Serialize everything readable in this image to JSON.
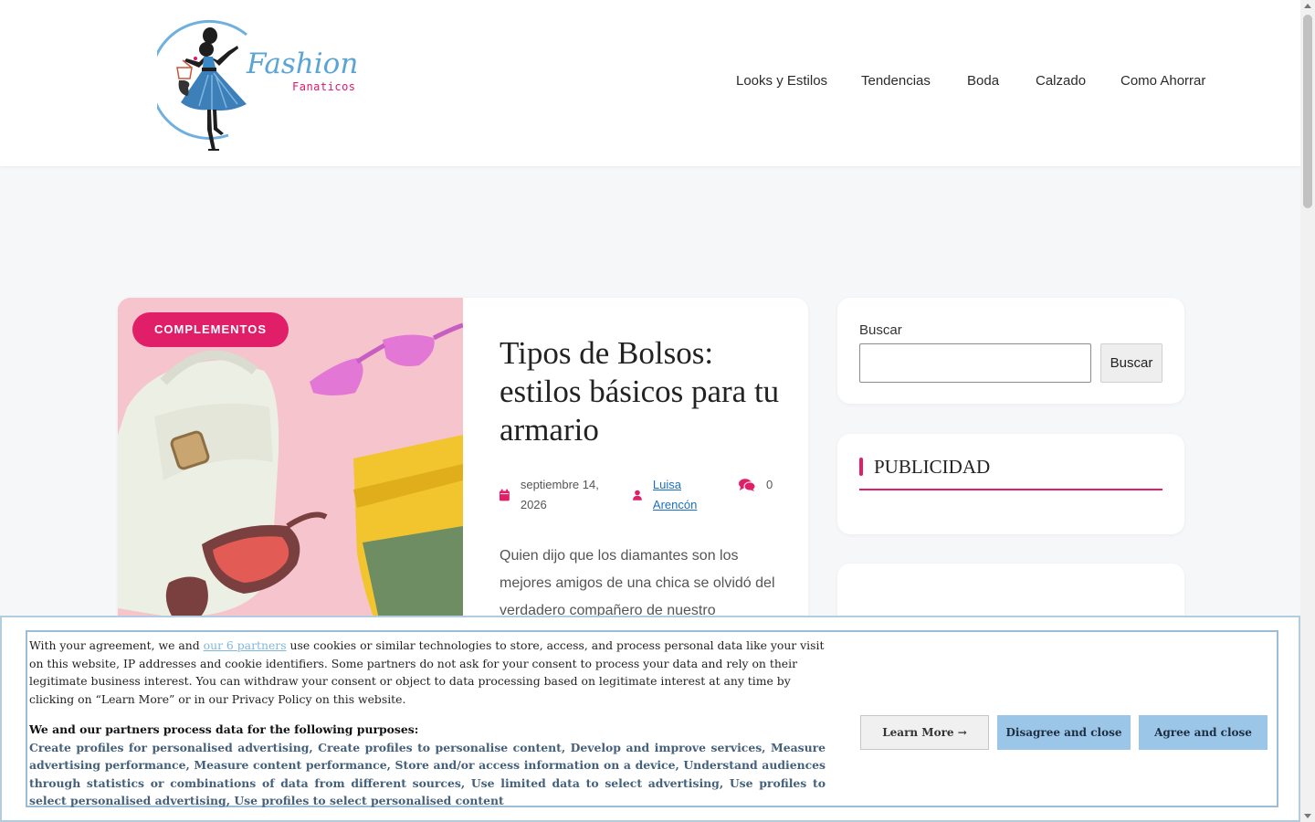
{
  "header": {
    "logo_text_main": "Fashion",
    "logo_text_sub": "Fanaticos",
    "nav": [
      "Looks y Estilos",
      "Tendencias",
      "Boda",
      "Calzado",
      "Como Ahorrar"
    ]
  },
  "article": {
    "category": "COMPLEMENTOS",
    "title": "Tipos de Bolsos: estilos básicos para tu armario",
    "date": "septiembre 14, 2026",
    "author": "Luisa Arencón",
    "comments": "0",
    "excerpt": "Quien dijo que los diamantes son los mejores amigos de una chica se olvidó del verdadero compañero de nuestro"
  },
  "sidebar": {
    "search_label": "Buscar",
    "search_value": "",
    "search_button": "Buscar",
    "ad_title": "PUBLICIDAD"
  },
  "cookie": {
    "intro_before_link": "With your agreement, we and ",
    "partners_link": "our 6 partners",
    "intro_after_link": " use cookies or similar technologies to store, access, and process personal data like your visit on this website, IP addresses and cookie identifiers. Some partners do not ask for your consent to process your data and rely on their legitimate business interest. You can withdraw your consent or object to data processing based on legitimate interest at any time by clicking on “Learn More” or in our Privacy Policy on this website.",
    "purposes_heading": "We and our partners process data for the following purposes:",
    "purposes": "Create profiles for personalised advertising, Create profiles to personalise content, Develop and improve services, Measure advertising performance, Measure content performance, Store and/or access information on a device, Understand audiences through statistics or combinations of data from different sources, Use limited data to select advertising, Use profiles to select personalised advertising, Use profiles to select personalised content",
    "learn_more": "Learn More →",
    "disagree": "Disagree and close",
    "agree": "Agree and close"
  },
  "colors": {
    "accent": "#e11f69",
    "logo_blue": "#5aa4d6",
    "cookie_button": "#9cc6e8"
  }
}
